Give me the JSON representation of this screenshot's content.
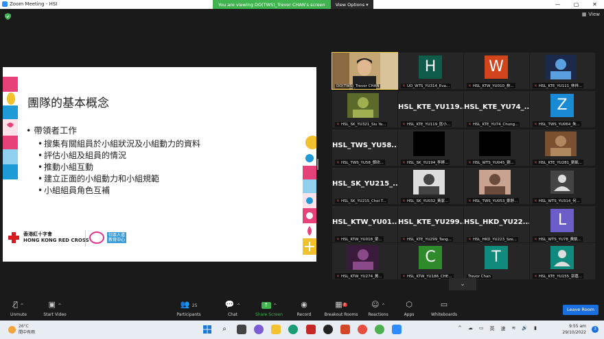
{
  "titlebar": {
    "app_title": "Zoom Meeting - HSI",
    "viewing_text": "You are viewing DO(TWS)_Trevor CHAN's screen",
    "view_options": "View Options ▾",
    "window_controls": [
      "—",
      "▢",
      "✕"
    ]
  },
  "topbar": {
    "view_label": "View"
  },
  "slide": {
    "title": "團隊的基本概念",
    "bullet": "帶領者工作",
    "subitems": [
      "搜集有關組員於小組狀況及小組動力的資料",
      "評估小組及組員的情況",
      "推動小組互動",
      "建立正面的小組動力和小組規範",
      "小組組員角色互補"
    ],
    "org_cn": "香港紅十字會",
    "org_en": "HONG KONG RED CROSS",
    "partner_text": "社區人道\n教育中心"
  },
  "gallery": [
    {
      "name": "DO(TWS)_Trevor CHAN",
      "type": "video",
      "muted": false
    },
    {
      "name": "UO_WTS_YU314_Eva...",
      "type": "avatar",
      "letter": "H",
      "color": "#0f5c4a",
      "muted": true
    },
    {
      "name": "HSL_KTW_YU010_林...",
      "type": "avatar",
      "letter": "W",
      "color": "#d2451c",
      "muted": true
    },
    {
      "name": "HSL_KTE_YU111_林祥...",
      "type": "image",
      "muted": true
    },
    {
      "name": "HSL_SK_YU321_Siu Ya...",
      "type": "image",
      "muted": true
    },
    {
      "name": "HSL_KTE_YU119_區小...",
      "type": "text",
      "big": "HSL_KTE_YU119...",
      "muted": true
    },
    {
      "name": "HSL_KTE_YU74_Chung...",
      "type": "text",
      "big": "HSL_KTE_YU74_...",
      "muted": true
    },
    {
      "name": "HSL_TWS_YU064_朱...",
      "type": "avatar",
      "letter": "Z",
      "color": "#1a8ad4",
      "muted": true
    },
    {
      "name": "HSL_TWS_YU58_鄧欣...",
      "type": "text",
      "big": "HSL_TWS_YU58...",
      "muted": true
    },
    {
      "name": "HSL_SK_YU194_李婷...",
      "type": "blank",
      "muted": true
    },
    {
      "name": "HSL_WTS_YU045_劉...",
      "type": "blank",
      "muted": true
    },
    {
      "name": "HSL_KTE_YU281_劉凱...",
      "type": "image",
      "muted": true
    },
    {
      "name": "HSL_SK_YU215_Choi T...",
      "type": "text",
      "big": "HSL_SK_YU215_...",
      "muted": true
    },
    {
      "name": "HSL_SK_YU032_黃家...",
      "type": "image",
      "muted": true
    },
    {
      "name": "HSL_TWS_YU053_鄭舒...",
      "type": "image",
      "muted": true
    },
    {
      "name": "HSL_WTS_YU314_何...",
      "type": "person",
      "muted": true
    },
    {
      "name": "HSL_KTW_YU018_梁...",
      "type": "text",
      "big": "HSL_KTW_YU01...",
      "muted": true
    },
    {
      "name": "HSL_KTE_YU299_Tang...",
      "type": "text",
      "big": "HSL_KTE_YU299...",
      "muted": true
    },
    {
      "name": "HSL_HKD_YU223_Sze...",
      "type": "text",
      "big": "HSL_HKD_YU22...",
      "muted": true
    },
    {
      "name": "HSL_WTS_YU78_黃凱...",
      "type": "avatar",
      "letter": "L",
      "color": "#6a5fc9",
      "muted": true
    },
    {
      "name": "HSL_KTW_YU274_黃...",
      "type": "image",
      "muted": true
    },
    {
      "name": "HSL_KTW_YU186_CHE...",
      "type": "avatar",
      "letter": "C",
      "color": "#2e8a2a",
      "muted": true
    },
    {
      "name": "Trevor Chan",
      "type": "avatar",
      "letter": "T",
      "color": "#0f8a7c",
      "muted": false
    },
    {
      "name": "HSL_KTE_YU155_郭嘉...",
      "type": "person",
      "color": "#0f8a7c",
      "muted": true
    }
  ],
  "toolbar": {
    "unmute": "Unmute",
    "start_video": "Start Video",
    "participants": "Participants",
    "participants_count": "25",
    "chat": "Chat",
    "share_screen": "Share Screen",
    "record": "Record",
    "breakout": "Breakout Rooms",
    "breakout_badge": "2",
    "reactions": "Reactions",
    "apps": "Apps",
    "whiteboards": "Whiteboards",
    "leave": "Leave Room"
  },
  "taskbar": {
    "temp": "26°C",
    "weather": "間中有雨",
    "time": "9:55 am",
    "date": "29/10/2022",
    "lang": "英",
    "ime": "速",
    "notifications": "3"
  },
  "colors": {
    "zoom_blue": "#1a6fe0",
    "viewing_green": "#3fb44f",
    "active_speaker": "#f5d34f",
    "muted_red": "#e53935"
  }
}
